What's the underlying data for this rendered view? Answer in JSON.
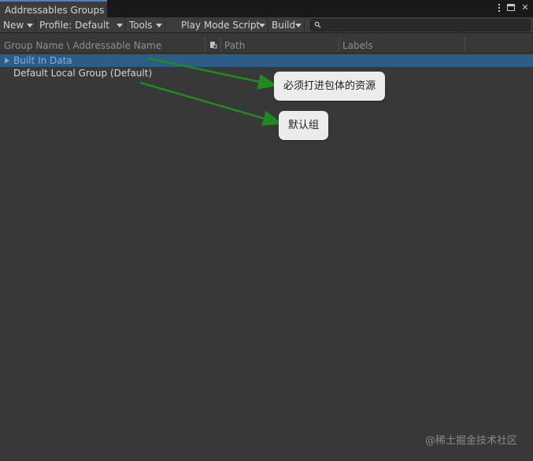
{
  "window": {
    "tab_title": "Addressables Groups"
  },
  "toolbar": {
    "new_label": "New",
    "profile_label": "Profile: Default",
    "tools_label": "Tools",
    "play_mode_label": "Play Mode Script",
    "build_label": "Build",
    "search_placeholder": ""
  },
  "columns": {
    "name": "Group Name \\ Addressable Name",
    "path": "Path",
    "labels": "Labels"
  },
  "groups": [
    {
      "label": "Built In Data",
      "selected": true
    },
    {
      "label": "Default Local Group (Default)",
      "selected": false
    }
  ],
  "annotations": {
    "builtin_note": "必须打进包体的资源",
    "default_note": "默认组"
  },
  "watermark": "@稀土掘金技术社区",
  "colors": {
    "selection": "#2c5d87",
    "arrow": "#1f8a1f",
    "background": "#383838"
  }
}
